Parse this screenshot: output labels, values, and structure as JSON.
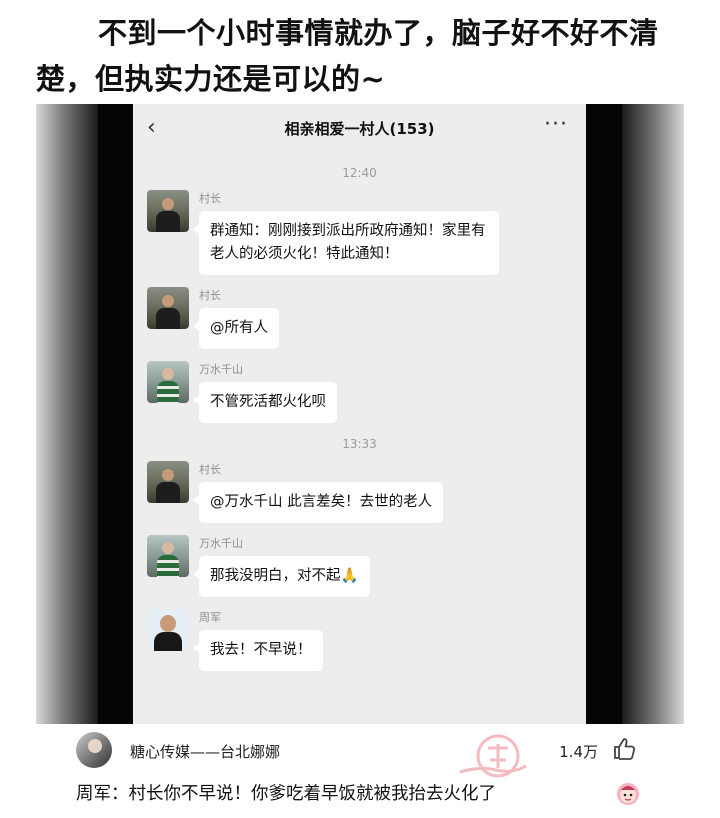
{
  "caption": "不到一个小时事情就办了，脑子好不好不清楚，但执实力还是可以的~",
  "chat": {
    "back_icon": "chevron-left-icon",
    "title": "相亲相爱一村人(153)",
    "more_icon": "more-dots-icon",
    "timestamps": [
      "12:40",
      "13:33"
    ],
    "messages": [
      {
        "sender": "村长",
        "avatar": "village-chief-avatar",
        "text": "群通知：刚刚接到派出所政府通知！家里有老人的必须火化！特此通知！"
      },
      {
        "sender": "村长",
        "avatar": "village-chief-avatar",
        "text": "@所有人"
      },
      {
        "sender": "万水千山",
        "avatar": "wanshui-avatar",
        "text": "不管死活都火化呗"
      },
      {
        "sender": "村长",
        "avatar": "village-chief-avatar",
        "text": "@万水千山 此言差矣！去世的老人"
      },
      {
        "sender": "万水千山",
        "avatar": "wanshui-avatar",
        "text": "那我没明白，对不起🙏"
      },
      {
        "sender": "周军",
        "avatar": "zhoujun-avatar",
        "text": "我去！不早说！"
      }
    ]
  },
  "comment": {
    "username": "糖心传媒——台北娜娜",
    "likes": "1.4万",
    "like_icon": "thumbs-up-icon",
    "text": "周军：村长你不早说！你爹吃着早饭就被我抬去火化了",
    "emoji_icon": "embarrassed-face-icon"
  },
  "colors": {
    "chat_bg": "#ededed",
    "bubble_bg": "#ffffff",
    "frame_bg": "#050505"
  }
}
